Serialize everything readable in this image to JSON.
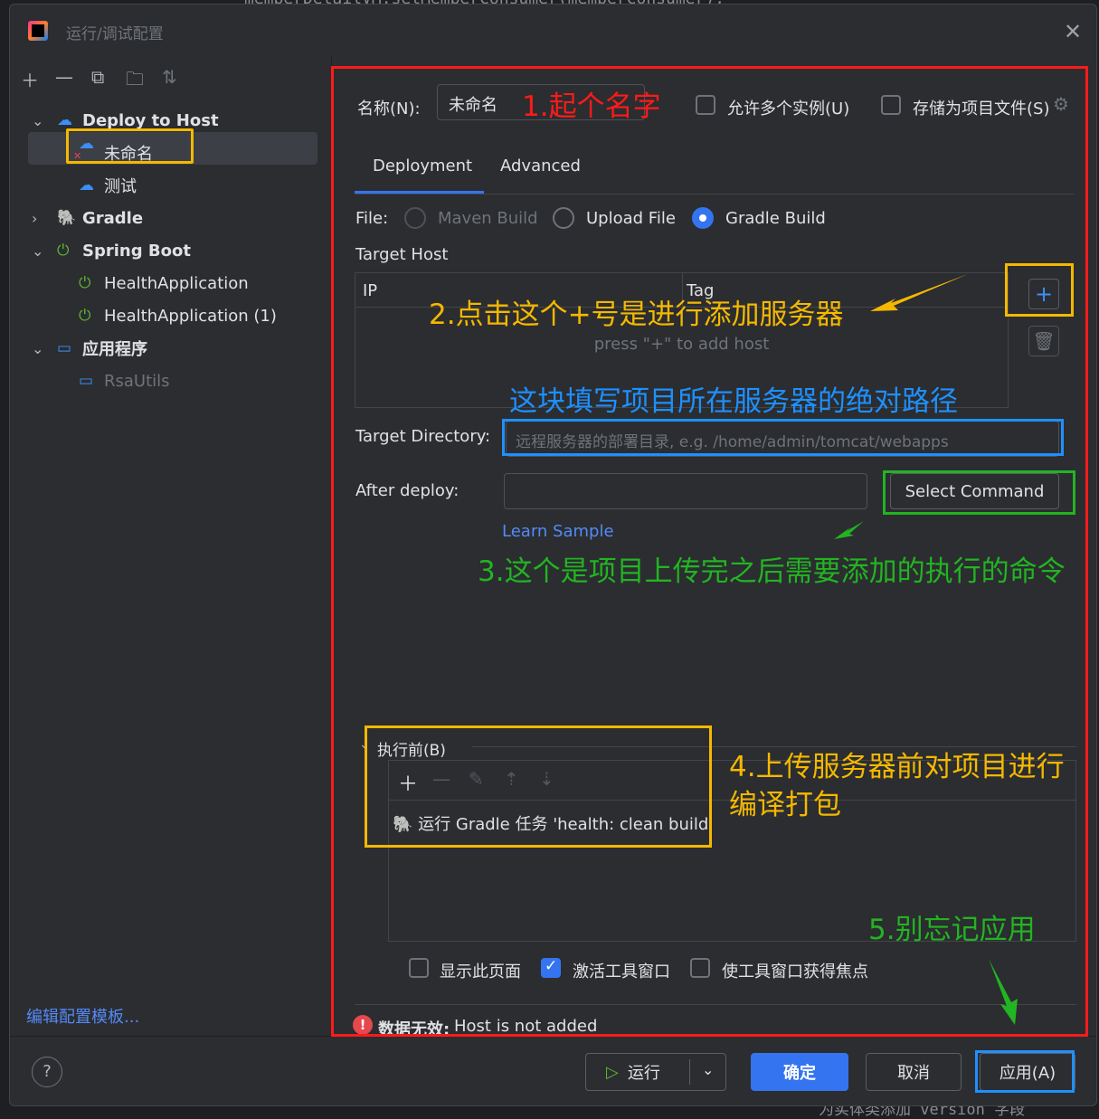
{
  "background": {
    "code_top": "memberDetailVM.setMemberConsumer(memberConsumer);",
    "code_bottom": "为实体类添加 version 字段"
  },
  "window": {
    "title": "运行/调试配置"
  },
  "left": {
    "toolbar": [
      "add-icon",
      "remove-icon",
      "copy-icon",
      "folder-icon",
      "sort-icon"
    ],
    "tree": {
      "deploy_group": "Deploy to Host",
      "deploy_item_unnamed": "未命名",
      "deploy_item_test": "测试",
      "gradle": "Gradle",
      "spring_boot": "Spring Boot",
      "sb_item1": "HealthApplication",
      "sb_item2": "HealthApplication (1)",
      "app_group": "应用程序",
      "app_item": "RsaUtils"
    },
    "edit_templates": "编辑配置模板..."
  },
  "form": {
    "name_label": "名称(N):",
    "name_value": "未命名",
    "allow_multiple": "允许多个实例(U)",
    "store_as_file": "存储为项目文件(S)",
    "tabs": [
      "Deployment",
      "Advanced"
    ],
    "file_label": "File:",
    "file_options": [
      "Maven Build",
      "Upload File",
      "Gradle Build"
    ],
    "target_host_label": "Target Host",
    "host_table_headers": [
      "IP",
      "Tag"
    ],
    "host_empty": "press \"+\" to add host",
    "target_dir_label": "Target Directory:",
    "target_dir_placeholder": "远程服务器的部署目录, e.g. /home/admin/tomcat/webapps",
    "after_deploy_label": "After deploy:",
    "select_command": "Select Command",
    "learn_sample": "Learn Sample",
    "before_launch_label": "执行前(B)",
    "before_launch_task": "运行 Gradle 任务 'health: clean build'",
    "show_page": "显示此页面",
    "activate_tool": "激活工具窗口",
    "focus_tool": "使工具窗口获得焦点",
    "error_prefix": "数据无效:",
    "error_text": "Host is not added"
  },
  "footer": {
    "run": "运行",
    "ok": "确定",
    "cancel": "取消",
    "apply": "应用(A)",
    "help": "?"
  },
  "annotations": {
    "a1": "1.起个名字",
    "a2": "2.点击这个+号是进行添加服务器",
    "a_dir": "这块填写项目所在服务器的绝对路径",
    "a3": "3.这个是项目上传完之后需要添加的执行的命令",
    "a4_line1": "4.上传服务器前对项目进行",
    "a4_line2": "编译打包",
    "a5": "5.别忘记应用",
    "colors": {
      "red": "#ff1a1a",
      "orange": "#f5b800",
      "blue": "#1e90ff",
      "green": "#22b422"
    }
  }
}
